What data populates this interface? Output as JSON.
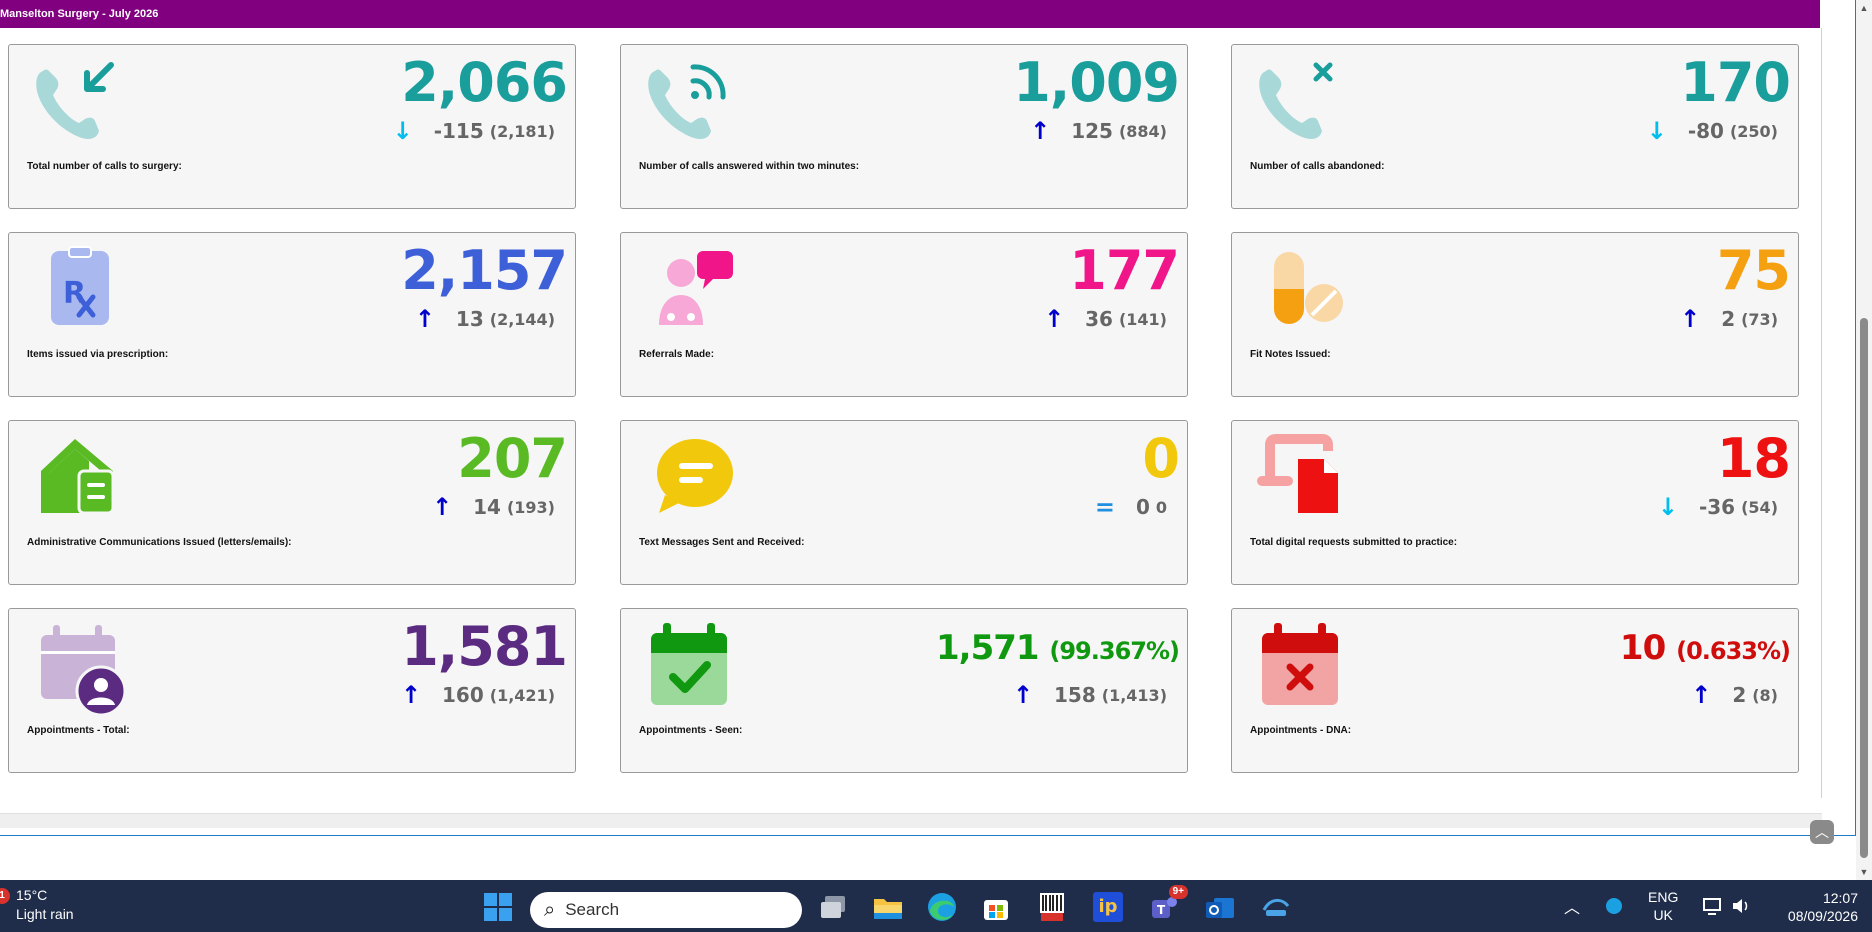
{
  "report": {
    "title": "Manselton Surgery - July 2026"
  },
  "cards": [
    {
      "value": "2,066",
      "value_color": "#1a9e9c",
      "arrow": "↓",
      "arrow_color": "#00bfef",
      "change": "-115",
      "previous": "(2,181)",
      "label": "Total number of calls to surgery:",
      "icon": "phone-incoming-icon"
    },
    {
      "value": "1,009",
      "value_color": "#1a9e9c",
      "arrow": "↑",
      "arrow_color": "#0000cc",
      "change": "125",
      "previous": "(884)",
      "label": "Number of calls answered within two minutes:",
      "icon": "phone-answered-icon"
    },
    {
      "value": "170",
      "value_color": "#1a9e9c",
      "arrow": "↓",
      "arrow_color": "#00bfef",
      "change": "-80",
      "previous": "(250)",
      "label": "Number of calls abandoned:",
      "icon": "phone-missed-icon"
    },
    {
      "value": "2,157",
      "value_color": "#3d5fd8",
      "arrow": "↑",
      "arrow_color": "#0000cc",
      "change": "13",
      "previous": "(2,144)",
      "label": "Items issued via prescription:",
      "icon": "prescription-icon"
    },
    {
      "value": "177",
      "value_color": "#f0168a",
      "arrow": "↑",
      "arrow_color": "#0000cc",
      "change": "36",
      "previous": "(141)",
      "label": "Referrals Made:",
      "icon": "doctor-chat-icon"
    },
    {
      "value": "75",
      "value_color": "#f5a010",
      "arrow": "↑",
      "arrow_color": "#0000cc",
      "change": "2",
      "previous": "(73)",
      "label": "Fit Notes Issued:",
      "icon": "pills-icon"
    },
    {
      "value": "207",
      "value_color": "#5aba24",
      "arrow": "↑",
      "arrow_color": "#0000cc",
      "change": "14",
      "previous": "(193)",
      "label": "Administrative Communications Issued (letters/emails):",
      "icon": "mail-house-icon"
    },
    {
      "value": "0",
      "value_color": "#f2c80c",
      "arrow": "=",
      "arrow_color": "#1f8fe0",
      "change": "0",
      "previous": "0",
      "label": "Text Messages Sent and Received:",
      "icon": "chat-bubble-icon"
    },
    {
      "value": "18",
      "value_color": "#ee1111",
      "arrow": "↓",
      "arrow_color": "#00bfef",
      "change": "-36",
      "previous": "(54)",
      "label": "Total digital requests submitted to practice:",
      "icon": "digital-request-icon"
    },
    {
      "value": "1,581",
      "value_color": "#5b2b82",
      "arrow": "↑",
      "arrow_color": "#0000cc",
      "change": "160",
      "previous": "(1,421)",
      "label": "Appointments - Total:",
      "icon": "calendar-person-icon"
    },
    {
      "value": "1,571",
      "value_pct": "(99.367%)",
      "value_color": "#109910",
      "arrow": "↑",
      "arrow_color": "#0000cc",
      "change": "158",
      "previous": "(1,413)",
      "label": "Appointments - Seen:",
      "icon": "calendar-check-icon"
    },
    {
      "value": "10",
      "value_pct": "(0.633%)",
      "value_color": "#d00d0d",
      "arrow": "↑",
      "arrow_color": "#0000cc",
      "change": "2",
      "previous": "(8)",
      "label": "Appointments - DNA:",
      "icon": "calendar-cross-icon"
    }
  ],
  "taskbar": {
    "weather_badge": "1",
    "temperature": "15°C",
    "weather": "Light rain",
    "search_placeholder": "Search",
    "teams_badge": "9+",
    "language": "ENG",
    "region": "UK",
    "time": "12:07",
    "date": "08/09/2026"
  }
}
